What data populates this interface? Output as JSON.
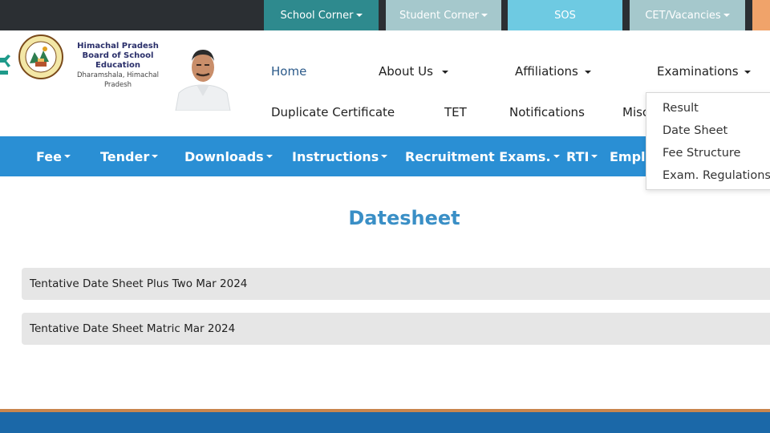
{
  "topbar": {
    "school_corner": "School Corner",
    "student_corner": "Student Corner",
    "sos": "SOS",
    "cet": "CET/Vacancies"
  },
  "header": {
    "board_line1": "Himachal Pradesh",
    "board_line2": "Board of School Education",
    "board_line3": "Dharamshala, Himachal Pradesh",
    "logo_text": "BOARD OF SCHOOL EDUCATION"
  },
  "nav": {
    "home": "Home",
    "about": "About Us",
    "affiliations": "Affiliations",
    "examinations": "Examinations",
    "duplicate": "Duplicate Certificate",
    "tet": "TET",
    "notifications": "Notifications",
    "misc": "Misc"
  },
  "menu": {
    "fee": "Fee",
    "tender": "Tender",
    "downloads": "Downloads",
    "instructions": "Instructions",
    "recruitment": "Recruitment Exams.",
    "rti": "RTI",
    "employ": "Emplo"
  },
  "dropdown": {
    "items": [
      "Result",
      "Date Sheet",
      "Fee Structure",
      "Exam. Regulations"
    ]
  },
  "main": {
    "title": "Datesheet",
    "items": [
      "Tentative Date Sheet Plus Two Mar 2024",
      "Tentative Date Sheet Matric Mar 2024"
    ]
  },
  "colors": {
    "topbar": "#2b2f33",
    "school_corner": "#2e8a8e",
    "student_corner": "#a5c8cc",
    "sos": "#6ecae2",
    "blue_menu": "#2a8fd4",
    "title": "#3a8fc6",
    "footer": "#1b68a8"
  }
}
